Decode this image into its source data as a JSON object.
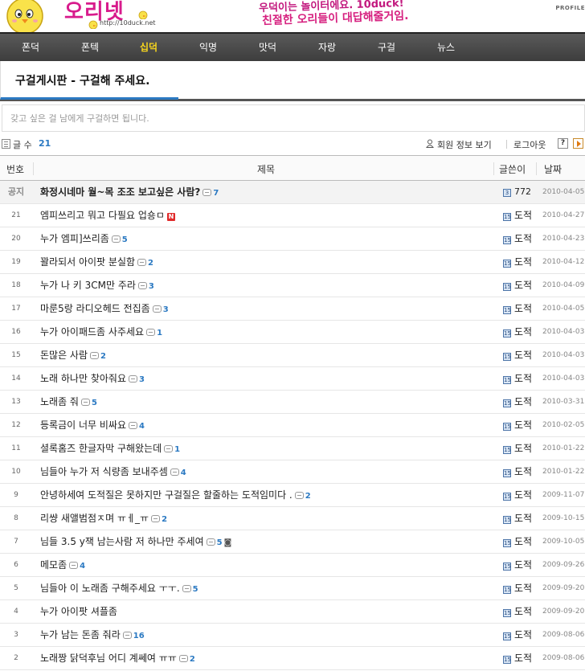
{
  "header": {
    "logo_text": "오리넷",
    "logo_url": "http://10duck.net",
    "banner_line1": "우덕이는 놀이터에요. 10duck!",
    "banner_line2": "친절한 오리들이 대답해줄거임.",
    "profile_tag": "PROFILE"
  },
  "nav": {
    "items": [
      {
        "label": "폰덕"
      },
      {
        "label": "폰텍"
      },
      {
        "label": "십덕"
      },
      {
        "label": "익명"
      },
      {
        "label": "맛덕"
      },
      {
        "label": "자랑"
      },
      {
        "label": "구걸"
      },
      {
        "label": "뉴스"
      }
    ],
    "active_index": 2
  },
  "board": {
    "title": "구걸게시판 - 구걸해 주세요.",
    "description": "갖고 싶은 걸 남에게 구걸하면 됩니다.",
    "count_label": "글 수",
    "count_value": "21",
    "member_info_link": "회원 정보 보기",
    "logout_link": "로그아웃",
    "help_label": "?"
  },
  "table": {
    "headers": {
      "no": "번호",
      "title": "제목",
      "author": "글쓴이",
      "date": "날짜"
    },
    "rows": [
      {
        "no": "공지",
        "title": "화정시네마 월~목 조조 보고싶은 사람?",
        "comments": "7",
        "author": "772",
        "level": "3",
        "date": "2010-04-05",
        "notice": true
      },
      {
        "no": "21",
        "title": "엠피쓰리고 뭐고 다필요 업숑ㅁ",
        "comments": "",
        "new": true,
        "author": "도적",
        "level": "15",
        "date": "2010-04-27"
      },
      {
        "no": "20",
        "title": "누가 엠피]쓰리좀",
        "comments": "5",
        "author": "도적",
        "level": "15",
        "date": "2010-04-23"
      },
      {
        "no": "19",
        "title": "꽐라되서 아이팟 분실함",
        "comments": "2",
        "author": "도적",
        "level": "15",
        "date": "2010-04-12"
      },
      {
        "no": "18",
        "title": "누가 나 키 3CM만 주라",
        "comments": "3",
        "author": "도적",
        "level": "15",
        "date": "2010-04-09"
      },
      {
        "no": "17",
        "title": "마룬5랑 라디오헤드 전집좀",
        "comments": "3",
        "author": "도적",
        "level": "15",
        "date": "2010-04-05"
      },
      {
        "no": "16",
        "title": "누가 아이패드좀 사주세요",
        "comments": "1",
        "author": "도적",
        "level": "15",
        "date": "2010-04-03"
      },
      {
        "no": "15",
        "title": "돈많은 사람",
        "comments": "2",
        "author": "도적",
        "level": "15",
        "date": "2010-04-03"
      },
      {
        "no": "14",
        "title": "노래 하나만 찾아줘요",
        "comments": "3",
        "author": "도적",
        "level": "15",
        "date": "2010-04-03"
      },
      {
        "no": "13",
        "title": "노래좀 줘",
        "comments": "5",
        "author": "도적",
        "level": "15",
        "date": "2010-03-31"
      },
      {
        "no": "12",
        "title": "등록금이 너무 비싸요",
        "comments": "4",
        "author": "도적",
        "level": "15",
        "date": "2010-02-05"
      },
      {
        "no": "11",
        "title": "셜록홈즈 한글자막 구해왔는데",
        "comments": "1",
        "author": "도적",
        "level": "15",
        "date": "2010-01-22"
      },
      {
        "no": "10",
        "title": "님들아 누가 저 식량좀 보내주셈",
        "comments": "4",
        "author": "도적",
        "level": "15",
        "date": "2010-01-22"
      },
      {
        "no": "9",
        "title": "안녕하세여 도적질은 못하지만 구걸질은 할줄하는 도적임미다 .",
        "comments": "2",
        "author": "도적",
        "level": "15",
        "date": "2009-11-07"
      },
      {
        "no": "8",
        "title": "리썅 새앨범점ㅈ며 ㅠㅔ_ㅠ",
        "comments": "2",
        "author": "도적",
        "level": "15",
        "date": "2009-10-15"
      },
      {
        "no": "7",
        "title": "님들 3.5 y잭 남는사람 저 하나만 주세여",
        "comments": "5",
        "extra": "◙",
        "author": "도적",
        "level": "15",
        "date": "2009-10-05"
      },
      {
        "no": "6",
        "title": "메모좀",
        "comments": "4",
        "author": "도적",
        "level": "15",
        "date": "2009-09-26"
      },
      {
        "no": "5",
        "title": "님들아 이 노래좀 구해주세요 ㅜㅜ.",
        "comments": "5",
        "author": "도적",
        "level": "15",
        "date": "2009-09-20"
      },
      {
        "no": "4",
        "title": "누가 아이팟 셔플좀",
        "comments": "",
        "author": "도적",
        "level": "15",
        "date": "2009-09-20"
      },
      {
        "no": "3",
        "title": "누가 남는 돈좀 줘라",
        "comments": "16",
        "author": "도적",
        "level": "15",
        "date": "2009-08-06"
      },
      {
        "no": "2",
        "title": "노래짱 닭덕후님 어디 계쎄여 ㅠㅠ",
        "comments": "2",
        "author": "도적",
        "level": "15",
        "date": "2009-08-06"
      }
    ]
  },
  "colors": {
    "accent": "#2b79c2",
    "nav_bg": "#4a4a4a",
    "nav_active": "#f7d51d",
    "logo": "#d81b8c",
    "new_badge": "#e02a2a"
  }
}
